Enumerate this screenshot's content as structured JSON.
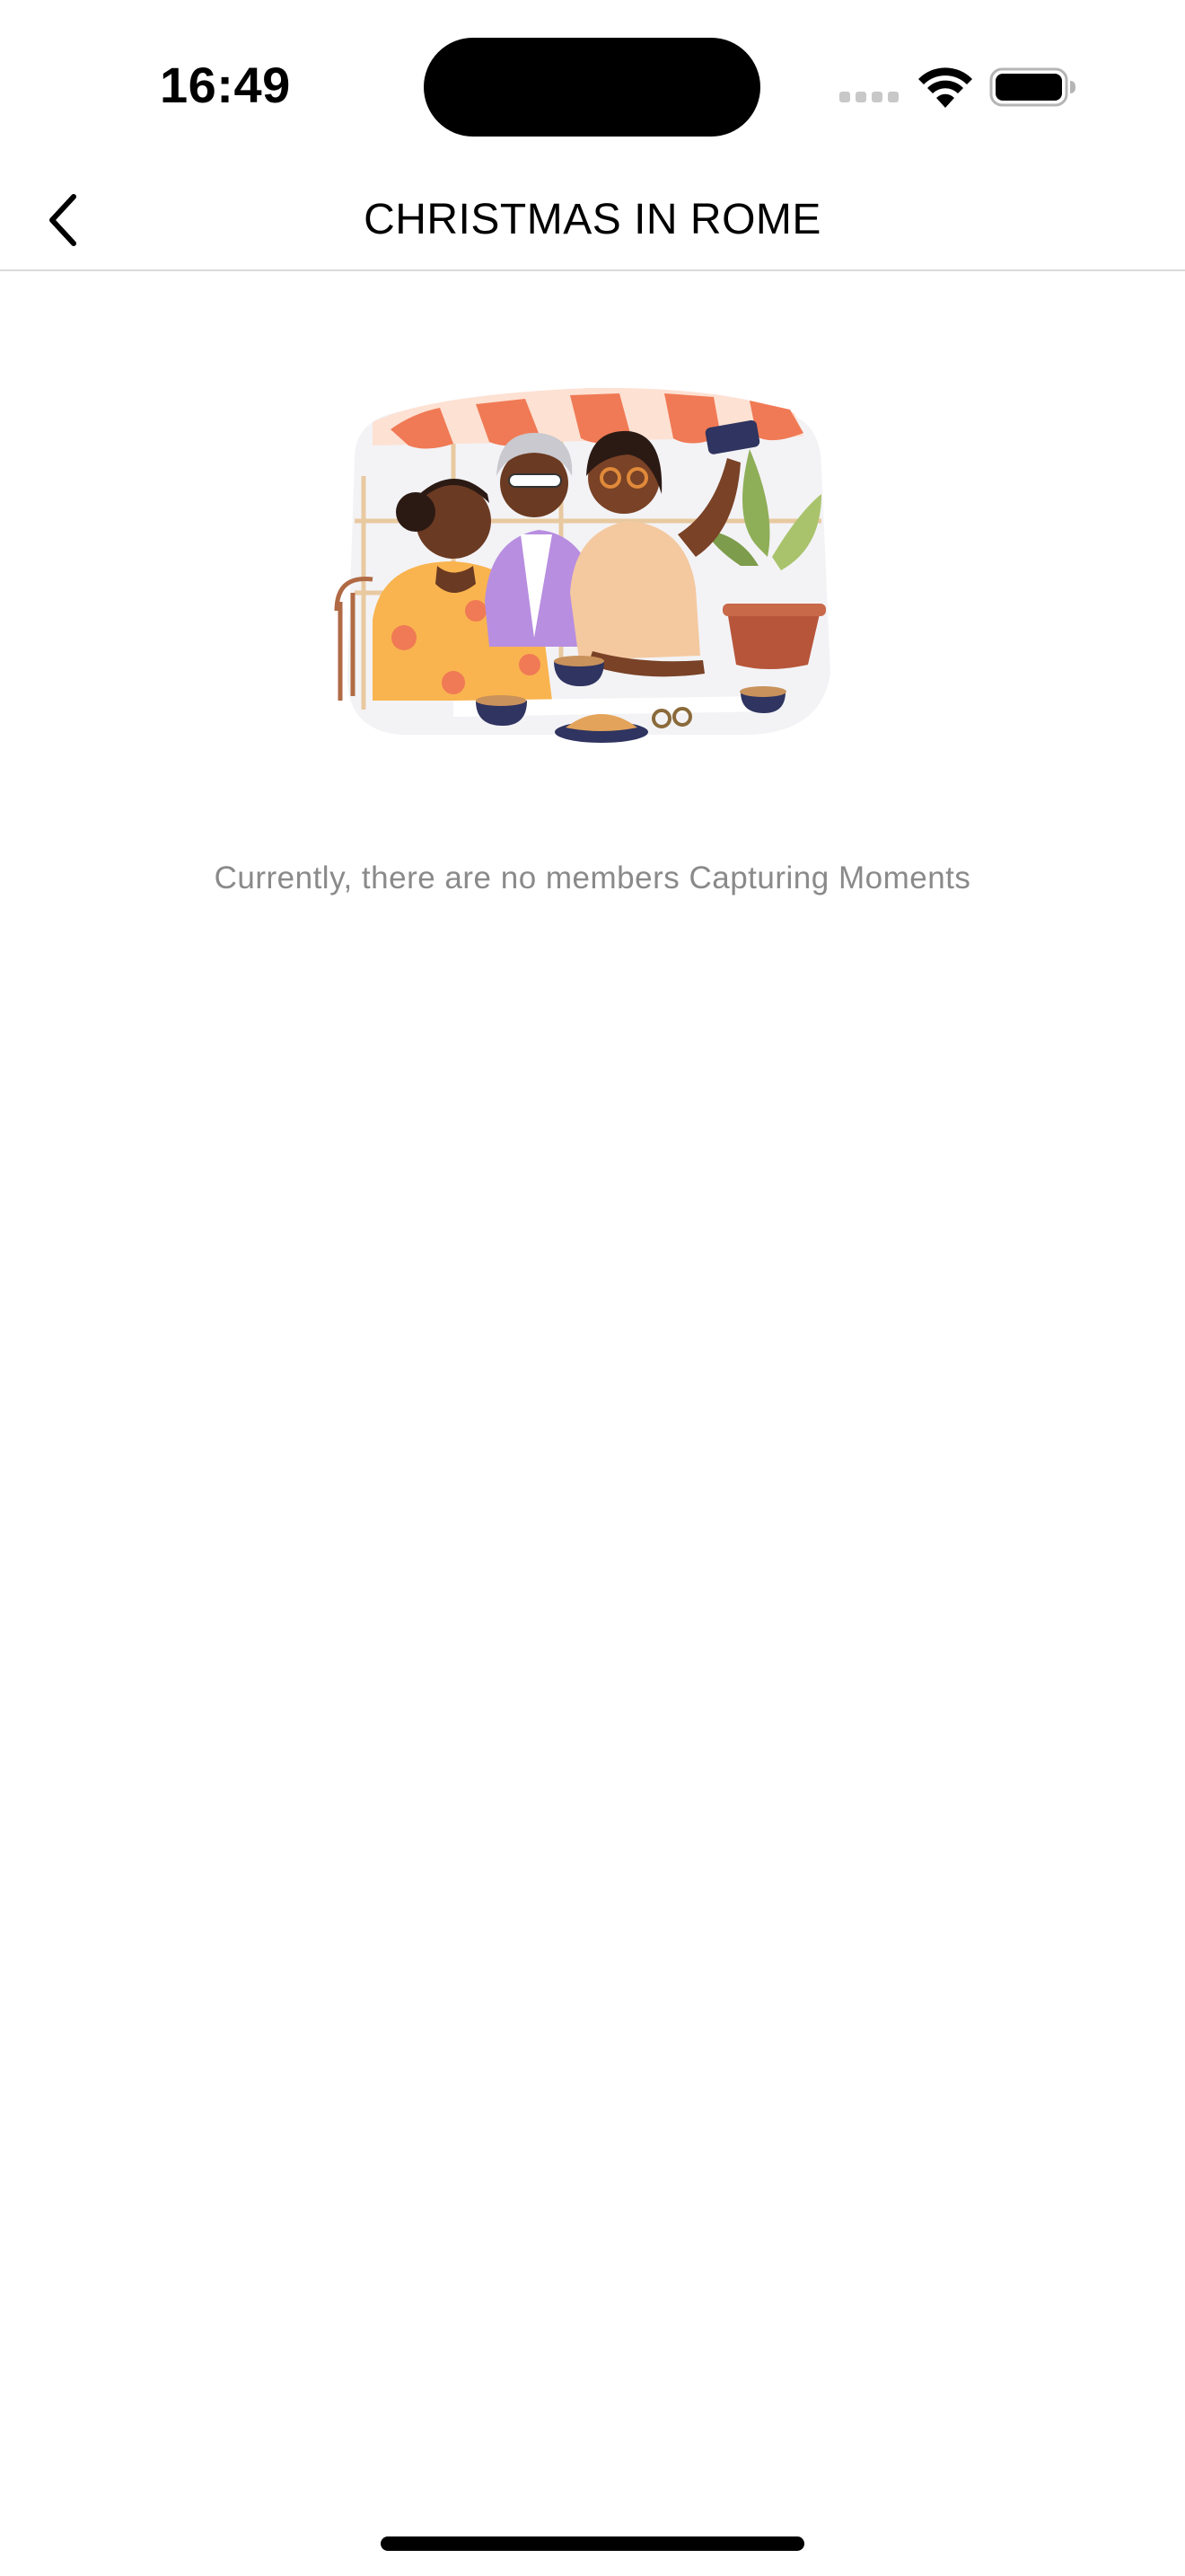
{
  "status_bar": {
    "time": "16:49",
    "icons": [
      "cellular-signal-icon",
      "wifi-icon",
      "battery-icon"
    ]
  },
  "nav": {
    "title": "CHRISTMAS IN ROME",
    "back_icon": "chevron-left-icon"
  },
  "empty_state": {
    "illustration": "friends-cafe-selfie-illustration",
    "message": "Currently, there are no members Capturing Moments"
  },
  "colors": {
    "background": "#ffffff",
    "title": "#000000",
    "message": "#8a8a8a",
    "divider": "#d9d9d9",
    "awning_stripe": "#f07a55",
    "awning_light": "#fde1d3"
  }
}
